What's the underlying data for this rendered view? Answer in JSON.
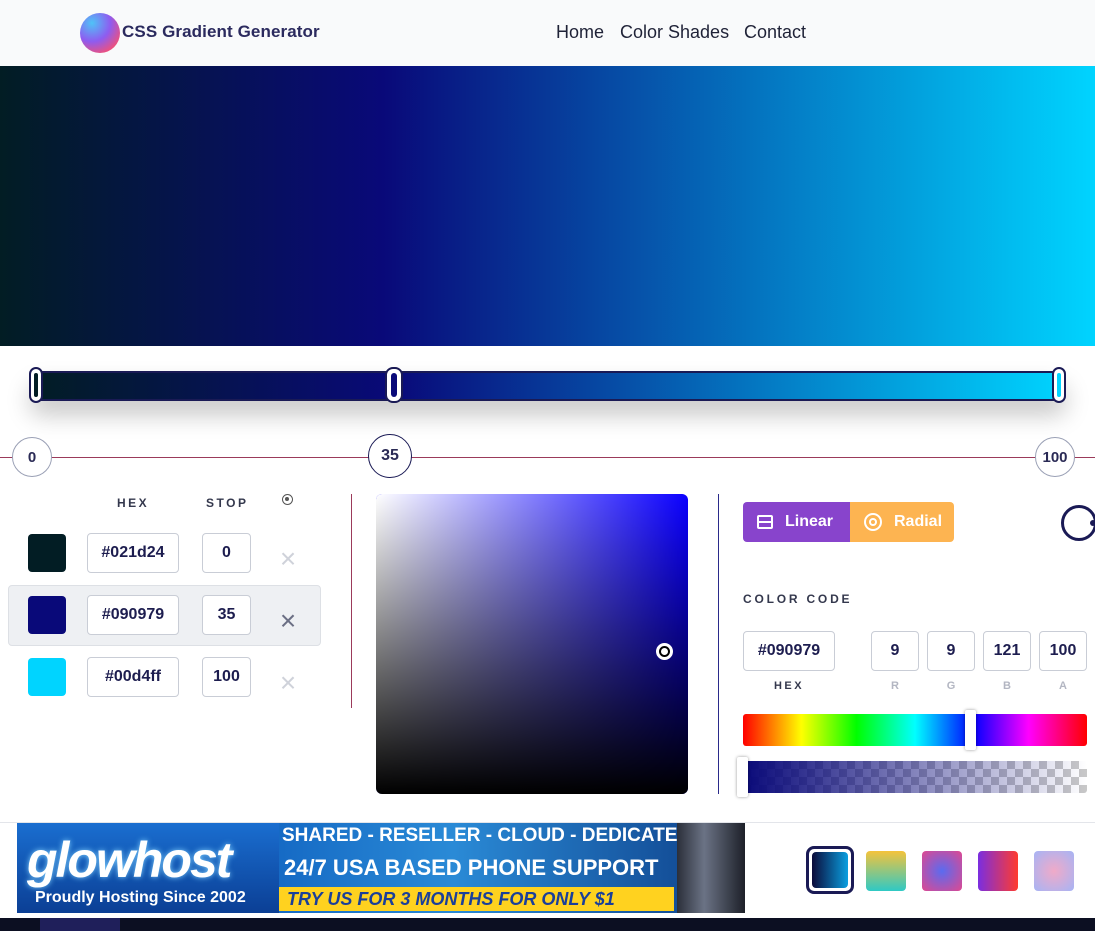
{
  "header": {
    "logo_text": "CSS Gradient Generator",
    "nav": [
      "Home",
      "Color Shades",
      "Contact"
    ]
  },
  "gradient": {
    "stops": [
      {
        "hex": "#021d24",
        "stop": "0",
        "color": "#021d24"
      },
      {
        "hex": "#090979",
        "stop": "35",
        "color": "#090979"
      },
      {
        "hex": "#00d4ff",
        "stop": "100",
        "color": "#00d4ff"
      }
    ],
    "selected_index": 1
  },
  "stops_table": {
    "hex_header": "HEX",
    "stop_header": "STOP",
    "remove_glyph": "×"
  },
  "type_buttons": {
    "linear_label": "Linear",
    "radial_label": "Radial",
    "linear_color": "#8844cc",
    "radial_color": "#fdb451"
  },
  "color_code": {
    "label": "COLOR CODE",
    "hex": "#090979",
    "r": "9",
    "g": "9",
    "b": "121",
    "a": "100",
    "labels": {
      "hex": "HEX",
      "r": "R",
      "g": "G",
      "b": "B",
      "a": "A"
    }
  },
  "ad": {
    "logo": "glowhost",
    "since": "Proudly Hosting Since 2002",
    "line1": "SHARED - RESELLER - CLOUD - DEDICATED",
    "line2": "24/7 USA BASED PHONE SUPPORT",
    "line3": "TRY US FOR 3 MONTHS FOR ONLY $1"
  },
  "presets": [
    {
      "from": "#0b0b3a",
      "to": "#0a9fe0",
      "selected": true
    },
    {
      "from": "#f5c33b",
      "to": "#2fc9c5",
      "selected": false
    },
    {
      "from": "#e0488f",
      "to": "#5a6bf0",
      "selected": false
    },
    {
      "from": "#7a2ee0",
      "to": "#ff3b2f",
      "selected": false
    },
    {
      "from": "#a6b4f5",
      "to": "#f0aac8",
      "selected": false
    }
  ]
}
